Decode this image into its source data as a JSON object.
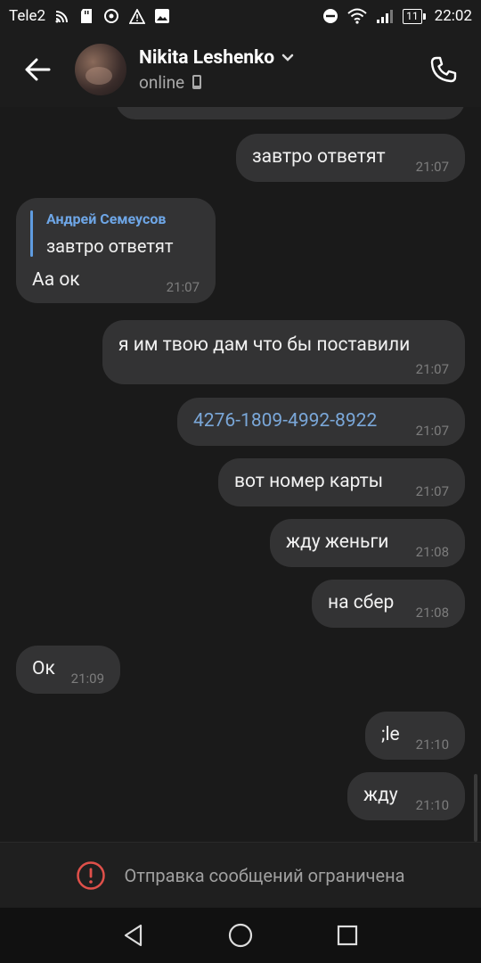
{
  "status_bar": {
    "carrier": "Tele2",
    "battery": "11",
    "time": "22:02"
  },
  "header": {
    "contact_name": "Nikita Leshenko",
    "status": "online"
  },
  "messages": [
    {
      "text": "завтро ответят",
      "time": "21:07",
      "outgoing": true
    },
    {
      "reply_author": "Андрей Семеусов",
      "reply_text": "завтро ответят",
      "text": "Аа ок",
      "time": "21:07",
      "outgoing": false
    },
    {
      "text": "я им твою дам что бы поставили",
      "time": "21:07",
      "outgoing": true
    },
    {
      "text": "4276-1809-4992-8922",
      "time": "21:07",
      "outgoing": true,
      "is_link": true
    },
    {
      "text": "вот номер карты",
      "time": "21:07",
      "outgoing": true
    },
    {
      "text": "жду женьги",
      "time": "21:08",
      "outgoing": true
    },
    {
      "text": "на сбер",
      "time": "21:08",
      "outgoing": true
    },
    {
      "text": "Ок",
      "time": "21:09",
      "outgoing": false
    },
    {
      "text": ";le",
      "time": "21:10",
      "outgoing": true
    },
    {
      "text": "жду",
      "time": "21:10",
      "outgoing": true
    }
  ],
  "restriction": {
    "text": "Отправка сообщений ограничена"
  },
  "colors": {
    "background": "#1a1a1a",
    "bubble": "#333334",
    "link": "#7aa7d8",
    "reply_accent": "#5f9ce0",
    "warning": "#e0504a"
  },
  "icons": {
    "back": "arrow-left-icon",
    "call": "phone-icon",
    "mobile": "mobile-device-icon",
    "warning": "exclamation-circle-icon"
  }
}
